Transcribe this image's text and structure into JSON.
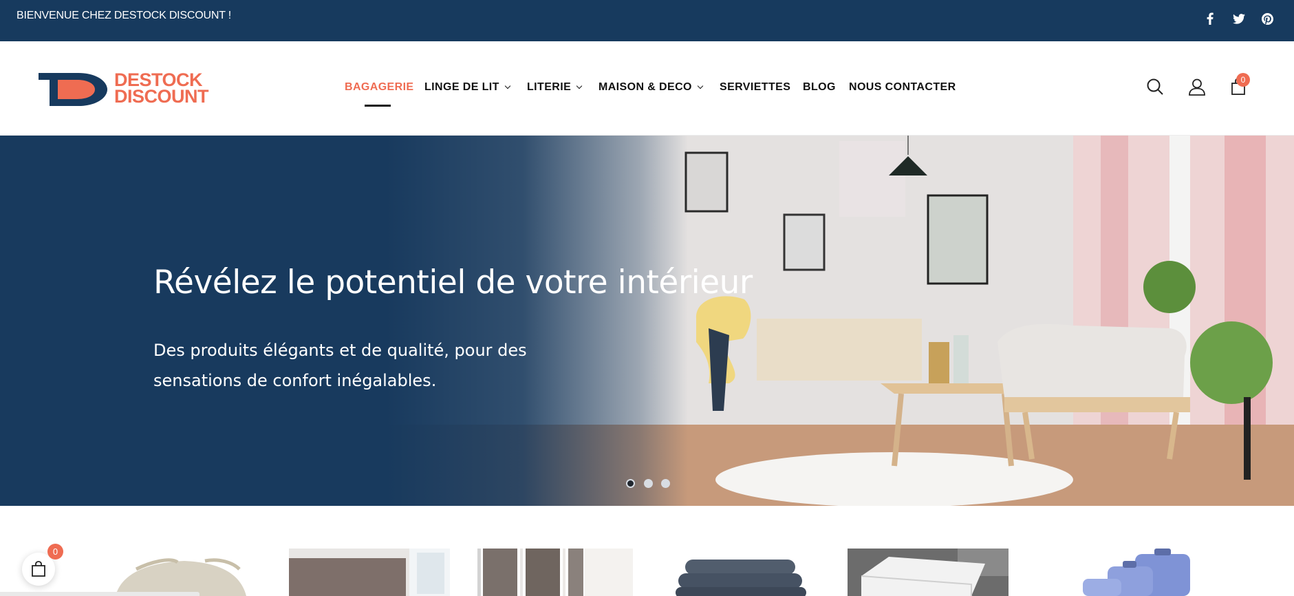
{
  "topbar": {
    "welcome": "BIENVENUE CHEZ DESTOCK DISCOUNT !",
    "social": [
      "facebook-icon",
      "twitter-icon",
      "pinterest-icon"
    ]
  },
  "header": {
    "logo_line1": "DESTOCK",
    "logo_line2": "DISCOUNT",
    "nav": [
      {
        "label": "BAGAGERIE",
        "active": true
      },
      {
        "label": "LINGE DE LIT",
        "dropdown": true
      },
      {
        "label": "LITERIE",
        "dropdown": true
      },
      {
        "label": "MAISON & DECO",
        "dropdown": true
      },
      {
        "label": "SERVIETTES"
      },
      {
        "label": "BLOG"
      },
      {
        "label": "NOUS CONTACTER"
      }
    ],
    "icons": [
      "search-icon",
      "user-icon",
      "cart-icon"
    ],
    "cart_count": "0"
  },
  "hero": {
    "title": "Révélez le potentiel de votre intérieur",
    "subtitle": "Des produits élégants et de qualité, pour des sensations de confort inégalables.",
    "slides": 3,
    "active_slide": 1
  },
  "categories": [
    "seat-cushions",
    "headboard-room",
    "curtains",
    "towels",
    "mattress",
    "luggage"
  ],
  "floating_cart": {
    "count": "0"
  },
  "colors": {
    "brand_navy": "#173a5e",
    "accent": "#ef6c52"
  }
}
